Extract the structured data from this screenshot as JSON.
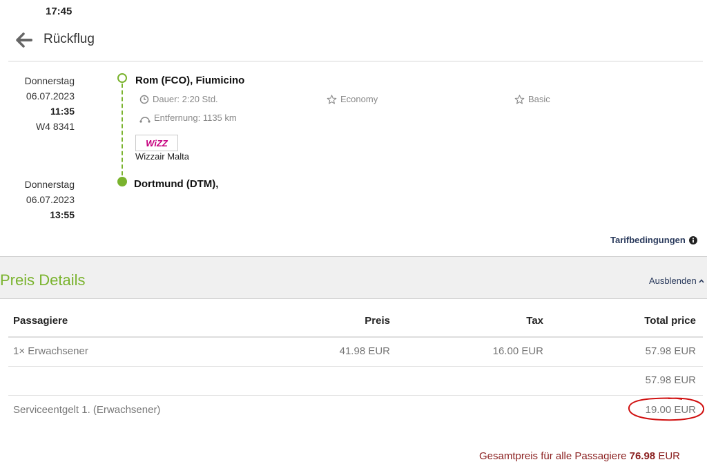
{
  "top": {
    "time": "17:45"
  },
  "header": {
    "title": "Rückflug"
  },
  "flight": {
    "departure": {
      "weekday": "Donnerstag",
      "date": "06.07.2023",
      "time": "11:35",
      "flight_no": "W4 8341",
      "airport": "Rom (FCO), Fiumicino"
    },
    "arrival": {
      "weekday": "Donnerstag",
      "date": "06.07.2023",
      "time": "13:55",
      "airport": "Dortmund (DTM),"
    },
    "duration": "Dauer: 2:20 Std.",
    "distance": "Entfernung: 1135 km",
    "cabin": "Economy",
    "fare": "Basic",
    "airline": {
      "logo_text": "WiZZ",
      "name": "Wizzair Malta",
      "logo_color": "#c6007e"
    },
    "timeline_color": "#7ab32e"
  },
  "tarif_link": "Tarifbedingungen",
  "price_details": {
    "title": "Preis Details",
    "hide_label": "Ausblenden",
    "columns": [
      "Passagiere",
      "Preis",
      "Tax",
      "Total price"
    ],
    "rows": [
      {
        "passenger": "1× Erwachsener",
        "price": "41.98 EUR",
        "tax": "16.00 EUR",
        "total": "57.98 EUR"
      },
      {
        "passenger": "",
        "price": "",
        "tax": "",
        "total": "57.98 EUR"
      },
      {
        "passenger": "Serviceentgelt 1. (Erwachsener)",
        "price": "",
        "tax": "",
        "total": "19.00 EUR"
      }
    ],
    "grand_total": {
      "label": "Gesamtpreis für alle Passagiere",
      "amount": "76.98",
      "currency": "EUR"
    }
  },
  "colors": {
    "accent_green": "#7ab32e",
    "link_blue": "#2a3a5c",
    "total_red": "#8a1f1f",
    "annotation_red": "#d01010"
  }
}
